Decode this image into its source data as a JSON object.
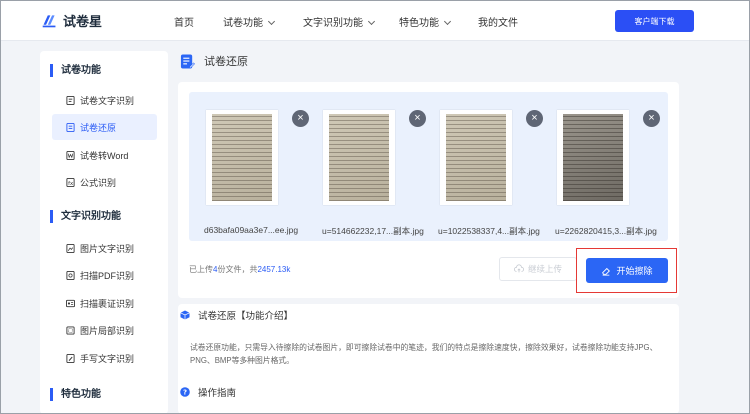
{
  "header": {
    "logo_text": "试卷星",
    "nav": [
      {
        "label": "首页",
        "has_dropdown": false
      },
      {
        "label": "试卷功能",
        "has_dropdown": true
      },
      {
        "label": "文字识别功能",
        "has_dropdown": true
      },
      {
        "label": "特色功能",
        "has_dropdown": true
      },
      {
        "label": "我的文件",
        "has_dropdown": false
      }
    ],
    "download_label": "客户端下载",
    "accent_color": "#2b4ff5"
  },
  "sidebar": {
    "sections": [
      {
        "title": "试卷功能",
        "items": [
          {
            "label": "试卷文字识别",
            "icon": "doc-text-icon",
            "active": false
          },
          {
            "label": "试卷还原",
            "icon": "doc-restore-icon",
            "active": true
          },
          {
            "label": "试卷转Word",
            "icon": "word-icon",
            "active": false
          },
          {
            "label": "公式识别",
            "icon": "formula-icon",
            "active": false
          }
        ]
      },
      {
        "title": "文字识别功能",
        "items": [
          {
            "label": "图片文字识别",
            "icon": "image-text-icon",
            "active": false
          },
          {
            "label": "扫描PDF识别",
            "icon": "pdf-icon",
            "active": false
          },
          {
            "label": "扫描裹证识别",
            "icon": "id-card-icon",
            "active": false
          },
          {
            "label": "图片局部识别",
            "icon": "image-crop-icon",
            "active": false
          },
          {
            "label": "手写文字识别",
            "icon": "handwriting-icon",
            "active": false
          }
        ]
      },
      {
        "title": "特色功能",
        "items": []
      }
    ]
  },
  "main": {
    "title": "试卷还原",
    "files": [
      {
        "name": "d63bafa09aa3e7...ee.jpg",
        "dark": false
      },
      {
        "name": "u=514662232,17...副本.jpg",
        "dark": false
      },
      {
        "name": "u=1022538337,4...副本.jpg",
        "dark": false
      },
      {
        "name": "u=2262820415,3...副本.jpg",
        "dark": true
      }
    ],
    "upload_info": {
      "prefix": "已上传",
      "count": "4",
      "middle": "份文件，共",
      "size": "2457.13k"
    },
    "continue_label": "继续上传",
    "start_label": "开始擦除",
    "intro": {
      "title": "试卷还原【功能介绍】",
      "text": "试卷还原功能，只需导入待擦除的试卷图片，即可擦除试卷中的笔迹，我们的特点是擦除速度快，擦除效果好，试卷擦除功能支持JPG、PNG、BMP等多种图片格式。"
    },
    "guide_title": "操作指南"
  }
}
